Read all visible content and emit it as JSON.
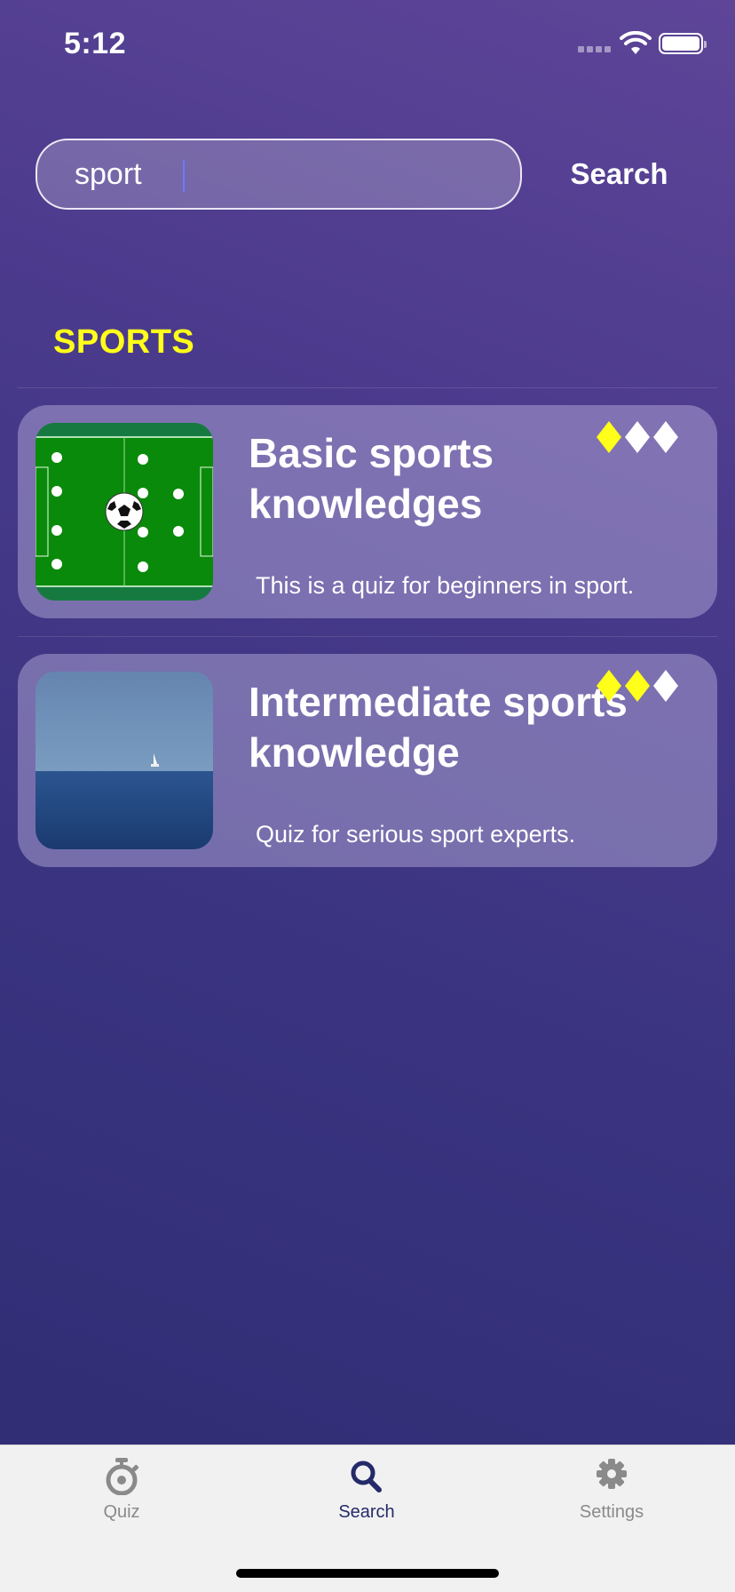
{
  "status_bar": {
    "time": "5:12"
  },
  "search": {
    "value": "sport",
    "button_label": "Search"
  },
  "section": {
    "title": "SPORTS"
  },
  "quizzes": [
    {
      "title": "Basic sports knowledges",
      "description": "This is a quiz for beginners in sport.",
      "thumbnail": "soccer-field-image",
      "difficulty": {
        "level": 1,
        "max": 3
      }
    },
    {
      "title": "Intermediate sports knowledge",
      "description": "Quiz for serious sport experts.",
      "thumbnail": "sailboat-sea-image",
      "difficulty": {
        "level": 2,
        "max": 3
      }
    }
  ],
  "tab_bar": {
    "tabs": [
      {
        "label": "Quiz",
        "icon": "stopwatch-icon",
        "active": false
      },
      {
        "label": "Search",
        "icon": "search-icon",
        "active": true
      },
      {
        "label": "Settings",
        "icon": "gear-icon",
        "active": false
      }
    ]
  },
  "colors": {
    "accent_yellow": "#ffff1a",
    "active_tab": "#252a6a",
    "inactive_tab": "#8a8a8a",
    "background_top": "#5e4598",
    "background_bottom": "#2e2c72"
  }
}
